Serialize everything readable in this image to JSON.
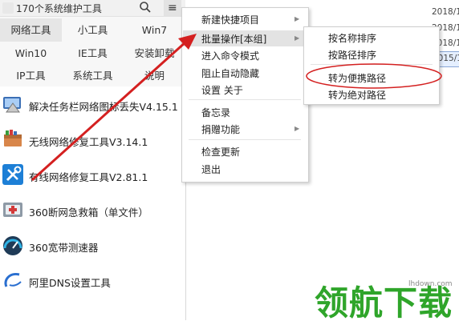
{
  "app": {
    "title": "170个系统维护工具"
  },
  "toolbar": {
    "menu_icon": "hamburger-icon",
    "search_icon": "search-icon"
  },
  "categories": [
    {
      "label": "网络工具",
      "active": true
    },
    {
      "label": "小工具",
      "active": false
    },
    {
      "label": "Win7",
      "active": false
    },
    {
      "label": "Win10",
      "active": false
    },
    {
      "label": "IE工具",
      "active": false
    },
    {
      "label": "安装卸载",
      "active": false
    },
    {
      "label": "IP工具",
      "active": false
    },
    {
      "label": "系统工具",
      "active": false
    },
    {
      "label": "说明",
      "active": false
    }
  ],
  "tools": [
    {
      "name": "解决任务栏网络图标丢失V4.15.1",
      "icon": "network-repair-icon"
    },
    {
      "name": "无线网络修复工具V3.14.1",
      "icon": "toolbox-icon"
    },
    {
      "name": "有线网络修复工具V2.81.1",
      "icon": "wrench-icon"
    },
    {
      "name": "360断网急救箱（单文件）",
      "icon": "first-aid-kit-icon"
    },
    {
      "name": "360宽带测速器",
      "icon": "speedometer-icon"
    },
    {
      "name": "阿里DNS设置工具",
      "icon": "alibaba-logo-icon"
    }
  ],
  "menu": {
    "items": [
      {
        "label": "新建快捷项目",
        "submenu": true
      },
      {
        "label": "批量操作[本组]",
        "submenu": true,
        "highlighted": true
      },
      {
        "label": "进入命令模式",
        "submenu": false
      },
      {
        "label": "阻止自动隐藏",
        "submenu": false
      },
      {
        "label": "设置 关于",
        "submenu": false
      },
      {
        "label": "备忘录",
        "submenu": false
      },
      {
        "label": "捐赠功能",
        "submenu": true
      },
      {
        "label": "检查更新",
        "submenu": false
      },
      {
        "label": "退出",
        "submenu": false
      }
    ]
  },
  "submenu": {
    "items": [
      {
        "label": "按名称排序"
      },
      {
        "label": "按路径排序"
      },
      {
        "label": "转为便携路径",
        "circled": true
      },
      {
        "label": "转为绝对路径"
      }
    ]
  },
  "right_pane": {
    "dates": [
      "2018/1",
      "2018/1",
      "2018/1",
      "2015/1"
    ]
  },
  "watermark": {
    "text": "领航下载",
    "url": "lhdown.com"
  },
  "colors": {
    "annotation_red": "#d42020",
    "watermark_green": "#2fa52a",
    "menu_highlight": "#e3e3e3"
  }
}
